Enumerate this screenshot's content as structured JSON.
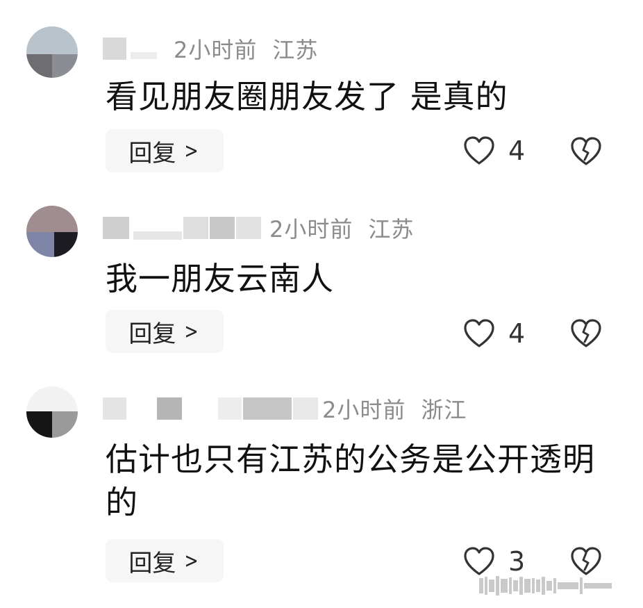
{
  "comments": [
    {
      "time": "2小时前",
      "location": "江苏",
      "text": "看见朋友圈朋友发了 是真的",
      "reply_label": "回复",
      "like_count": "4"
    },
    {
      "time": "2小时前",
      "location": "江苏",
      "text": "我一朋友云南人",
      "reply_label": "回复",
      "like_count": "4"
    },
    {
      "time": "2小时前",
      "location": "浙江",
      "text": "估计也只有江苏的公务是公开透明的",
      "reply_label": "回复",
      "like_count": "3"
    }
  ],
  "icons": {
    "like": "heart-outline-icon",
    "dislike": "broken-heart-icon",
    "reply_arrow": "chevron-right-icon"
  },
  "colors": {
    "text": "#111111",
    "meta": "#8b8b8b",
    "reply_bg": "#f6f6f6"
  }
}
